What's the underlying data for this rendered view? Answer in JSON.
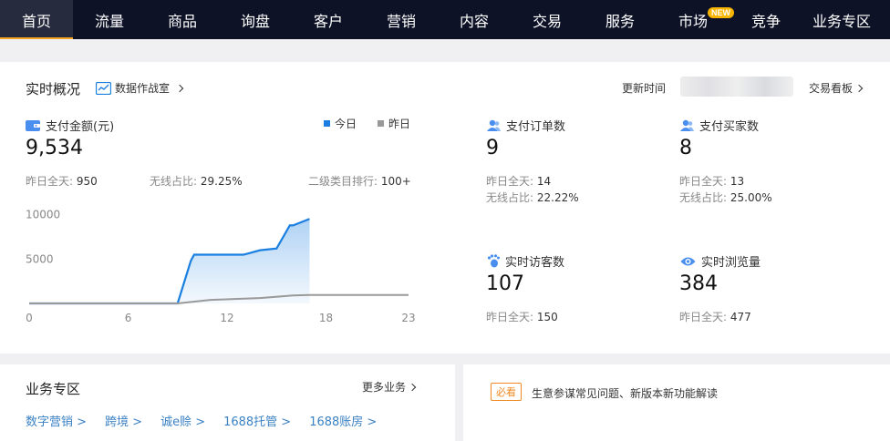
{
  "nav": {
    "items": [
      "首页",
      "流量",
      "商品",
      "询盘",
      "客户",
      "营销",
      "内容",
      "交易",
      "服务",
      "市场",
      "竞争",
      "业务专区"
    ],
    "active_index": 0,
    "new_badge": "NEW"
  },
  "overview": {
    "title": "实时概况",
    "studio_link": "数据作战室",
    "update_label": "更新时间",
    "board_link": "交易看板",
    "pay_amount": {
      "label": "支付金额(元)",
      "value": "9,534",
      "yesterday_label": "昨日全天:",
      "yesterday_value": "950",
      "wireless_label": "无线占比:",
      "wireless_value": "29.25%",
      "rank_label": "二级类目排行:",
      "rank_value": "100+"
    },
    "legend": {
      "today": "今日",
      "yesterday": "昨日"
    },
    "pay_orders": {
      "label": "支付订单数",
      "value": "9",
      "yesterday_label": "昨日全天:",
      "yesterday_value": "14",
      "wireless_label": "无线占比:",
      "wireless_value": "22.22%"
    },
    "pay_buyers": {
      "label": "支付买家数",
      "value": "8",
      "yesterday_label": "昨日全天:",
      "yesterday_value": "13",
      "wireless_label": "无线占比:",
      "wireless_value": "25.00%"
    },
    "visitors": {
      "label": "实时访客数",
      "value": "107",
      "yesterday_label": "昨日全天:",
      "yesterday_value": "150"
    },
    "pageviews": {
      "label": "实时浏览量",
      "value": "384",
      "yesterday_label": "昨日全天:",
      "yesterday_value": "477"
    }
  },
  "chart_data": {
    "type": "area",
    "x_ticks": [
      0,
      6,
      12,
      18,
      23
    ],
    "y_ticks": [
      5000,
      10000
    ],
    "ylim": [
      0,
      11000
    ],
    "xlim": [
      0,
      23
    ],
    "series": [
      {
        "name": "今日",
        "color": "#1a7fe0",
        "x": [
          0,
          9,
          9.8,
          10,
          13,
          14,
          15,
          15.8,
          16,
          17
        ],
        "values": [
          0,
          0,
          4800,
          5500,
          5500,
          6000,
          6200,
          8800,
          8800,
          9534
        ]
      },
      {
        "name": "昨日",
        "color": "#999999",
        "x": [
          0,
          9,
          11,
          14,
          16,
          17,
          23
        ],
        "values": [
          0,
          0,
          400,
          600,
          900,
          950,
          950
        ]
      }
    ]
  },
  "business": {
    "title": "业务专区",
    "more": "更多业务",
    "links": [
      "数字营销 >",
      "跨境 >",
      "诚e赊 >",
      "1688托管 >",
      "1688账房 >"
    ]
  },
  "news": {
    "tag": "必看",
    "text": "生意参谋常见问题、新版本新功能解读"
  },
  "colors": {
    "nav_bg": "#0d1227",
    "accent": "#1a7fe0",
    "active_underline": "#f6a623",
    "link": "#3b82c4"
  }
}
